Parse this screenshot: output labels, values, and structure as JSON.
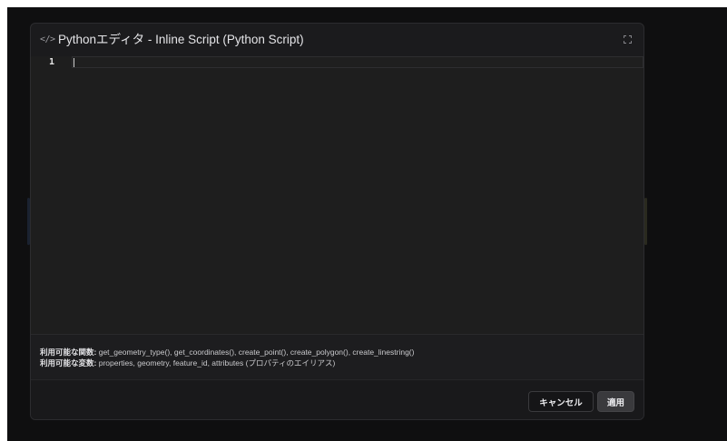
{
  "dialog": {
    "icon": "code-icon",
    "title": "Pythonエディタ - Inline Script (Python Script)",
    "expand_icon": "expand-icon"
  },
  "editor": {
    "line_numbers": [
      "1"
    ],
    "content": ""
  },
  "info": {
    "functions_label": "利用可能な関数:",
    "functions_value": "get_geometry_type(), get_coordinates(), create_point(), create_polygon(), create_linestring()",
    "variables_label": "利用可能な変数:",
    "variables_value": "properties, geometry, feature_id, attributes (プロパティのエイリアス)"
  },
  "footer": {
    "cancel_label": "キャンセル",
    "apply_label": "適用"
  },
  "colors": {
    "backdrop": "#0f0f10",
    "dialog_bg": "#1b1b1d",
    "editor_bg": "#1e1e1e",
    "text": "#e4e4e7"
  }
}
